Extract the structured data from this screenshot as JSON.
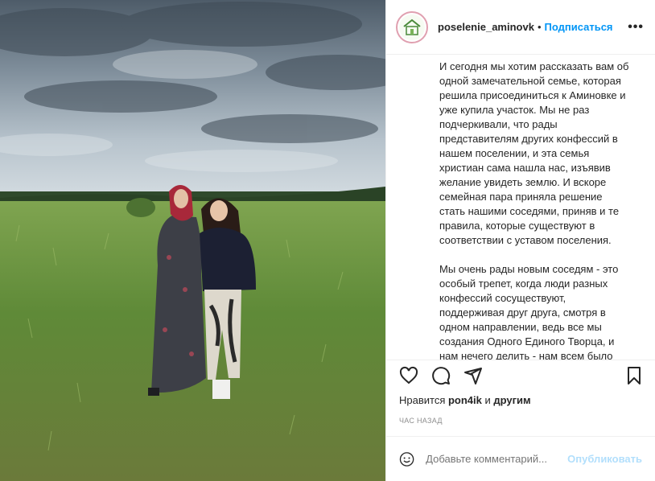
{
  "header": {
    "username": "poselenie_aminovk",
    "separator": "•",
    "follow_label": "Подписаться",
    "more_label": "•••"
  },
  "caption": {
    "paragraph1": "И сегодня мы хотим рассказать вам об одной замечательной семье, которая решила присоединиться к Аминовке и уже купила участок. Мы не раз подчеркивали, что рады представителям других конфессий в нашем поселении, и эта семья христиан сама нашла нас, изъявив желание увидеть землю. И вскоре семейная пара приняла решение стать нашими соседями, приняв и те правила, которые существуют в соответствии с уставом поселения.",
    "paragraph2": "Мы очень рады новым соседям - это особый трепет, когда люди разных конфессий сосуществуют, поддерживая друг друга, смотря в одном направлении, ведь все мы создания Одного Единого Творца, и нам нечего делить - нам всем было"
  },
  "actions": {
    "like_icon": "heart-icon",
    "comment_icon": "comment-icon",
    "share_icon": "share-icon",
    "save_icon": "bookmark-icon"
  },
  "likes": {
    "prefix": "Нравится ",
    "user": "pon4ik",
    "suffix": " и ",
    "others": "другим"
  },
  "time": "ЧАС НАЗАД",
  "comment": {
    "placeholder": "Добавьте комментарий...",
    "publish_label": "Опубликовать"
  },
  "colors": {
    "accent": "#0095f6",
    "publish_disabled": "#b2dffc",
    "muted": "#8e8e8e"
  }
}
